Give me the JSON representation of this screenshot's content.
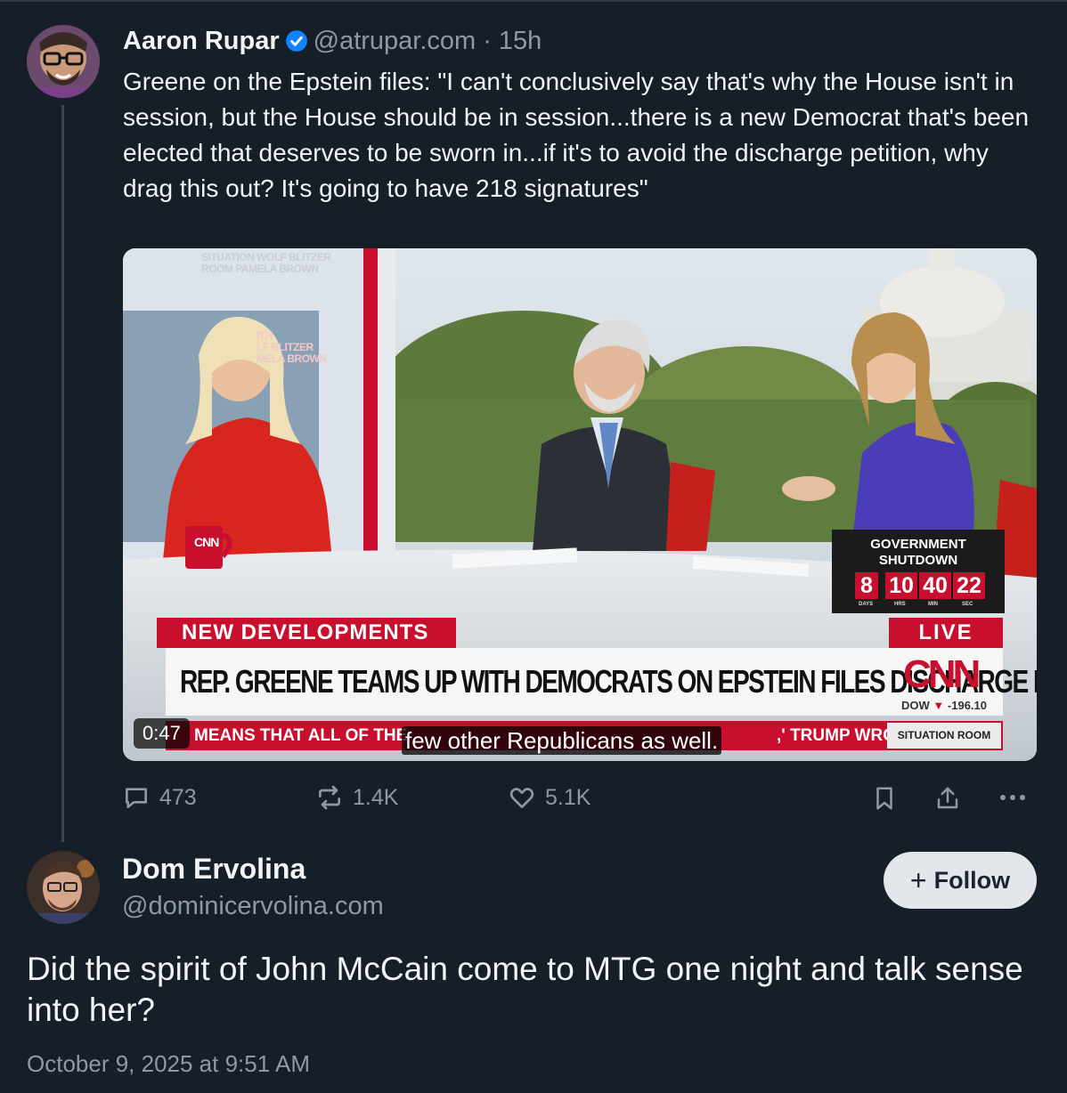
{
  "post": {
    "author_name": "Aaron Rupar",
    "handle": "@atrupar.com",
    "separator": "·",
    "time_ago": "15h",
    "text": "Greene on the Epstein files: \"I can't conclusively say that's why the House isn't in session, but the House should be in session...there is a new Democrat that's been elected that deserves to be sworn in...if it's to avoid the discharge petition, why drag this out? It's going to have 218 signatures\"",
    "verified": true,
    "video": {
      "show_logo": "THE\nSITUATION ROOM\nWOLF BLITZER\nPAMELA BROWN",
      "show_logo_line1": "SITUATION WOLF BLITZER",
      "show_logo_line2": "ROOM PAMELA BROWN",
      "background_logo_line1": "ITH",
      "background_logo_line2": "LF BLITZER",
      "background_logo_line3": "MELA BROWN",
      "mug_brand": "CNN",
      "banner_label": "NEW DEVELOPMENTS",
      "live_label": "LIVE",
      "headline": "REP. GREENE TEAMS UP WITH DEMOCRATS ON EPSTEIN FILES DISCHARGE PETITION",
      "network_logo": "CNN",
      "dow_label": "DOW",
      "dow_value": "-196.10",
      "ticker_left": "MEANS THAT ALL OF THE",
      "ticker_right": ",' TRUMP WROT",
      "ticker_badge": "SITUATION ROOM",
      "countdown_title_1": "GOVERNMENT",
      "countdown_title_2": "SHUTDOWN",
      "countdown": [
        {
          "value": "8",
          "label": "DAYS"
        },
        {
          "value": "10",
          "label": "HRS"
        },
        {
          "value": "40",
          "label": "MIN"
        },
        {
          "value": "22",
          "label": "SEC"
        }
      ],
      "caption": "few other Republicans as well.",
      "duration": "0:47"
    },
    "actions": {
      "replies": "473",
      "reposts": "1.4K",
      "likes": "5.1K"
    }
  },
  "reply": {
    "author_name": "Dom Ervolina",
    "handle": "@dominicervolina.com",
    "follow_label": "Follow",
    "follow_icon": "+",
    "text": "Did the spirit of John McCain come to MTG one night and talk sense into her?",
    "date": "October 9, 2025 at 9:51 AM"
  },
  "colors": {
    "background": "#161e27",
    "muted": "#8c99a8",
    "verified": "#1083fe",
    "cnn_red": "#c8102e"
  }
}
